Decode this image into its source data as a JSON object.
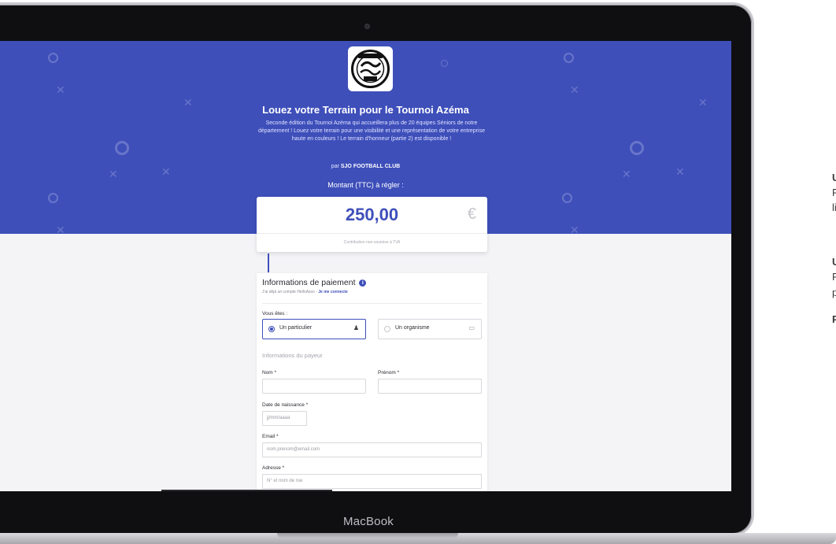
{
  "side_text": {
    "line1": "U",
    "line2": "P",
    "line3": "li",
    "line4": "U",
    "line5": "P",
    "line6": "p",
    "line7": "P"
  },
  "laptop": {
    "brand": "MacBook"
  },
  "campaign": {
    "title": "Louez votre Terrain pour le Tournoi Azéma",
    "description": "Seconde édition du Tournoi Azéma qui accueillera plus de 20 équipes Séniors de notre département ! Louez votre terrain pour une visibilité et une représentation de votre entreprise haute en couleurs ! Le terrain d'honneur (partie 2) est disponible !",
    "by_prefix": "par",
    "organizer": "SJO FOOTBALL CLUB",
    "amount_label": "Montant (TTC) à régler :",
    "amount": "250,00",
    "currency": "€",
    "tva_note": "Contribution non-soumise à TVA",
    "logo_alt": "SJO Football Club logo"
  },
  "payment": {
    "title": "Informations de paiement",
    "info_icon": "i",
    "account_prefix": "J'ai déjà un compte HelloAsso -",
    "account_link": "Je me connecte",
    "you_are_label": "Vous êtes :",
    "option_individual": "Un particulier",
    "option_organization": "Un organisme",
    "payer_heading": "Informations du payeur",
    "last_name_label": "Nom *",
    "first_name_label": "Prénom *",
    "birthdate_label": "Date de naissance *",
    "birthdate_placeholder": "jj/mm/aaaa",
    "email_label": "Email *",
    "email_placeholder": "nom.prenom@email.com",
    "address_label": "Adresse *",
    "address_placeholder": "N° et nom de rue"
  },
  "colors": {
    "primary": "#3e4fba",
    "hero": "#3e4fba",
    "page_bg": "#f4f4f7",
    "laptop_bezel": "#0f0f11"
  },
  "icons": {
    "individual": "person-icon",
    "organization": "briefcase-icon",
    "info": "info-icon"
  }
}
